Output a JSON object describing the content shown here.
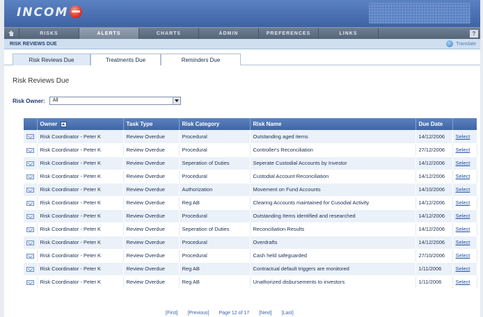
{
  "app": {
    "logo": "INCOM"
  },
  "nav": {
    "items": [
      {
        "label": "RISKS",
        "active": false
      },
      {
        "label": "ALERTS",
        "active": true
      },
      {
        "label": "CHARTS",
        "active": false
      },
      {
        "label": "ADMIN",
        "active": false
      },
      {
        "label": "PREFERENCES",
        "active": false
      },
      {
        "label": "LINKS",
        "active": false
      }
    ],
    "help": "?"
  },
  "section": {
    "title": "RISK REVIEWS DUE",
    "translate": "Translate"
  },
  "tabs": [
    {
      "label": "Risk Reviews Due",
      "active": true
    },
    {
      "label": "Treatments Due",
      "active": false
    },
    {
      "label": "Reminders Due",
      "active": false
    }
  ],
  "page": {
    "heading": "Risk Reviews Due"
  },
  "filter": {
    "label": "Risk Owner:",
    "value": "All"
  },
  "table": {
    "headers": [
      "Owner",
      "Task Type",
      "Risk Category",
      "Risk Name",
      "Due Date"
    ],
    "select_label": "Select",
    "rows": [
      {
        "owner": "Risk Coordinator - Peter K",
        "task": "Review Overdue",
        "category": "Procedural",
        "name": "Outstanding aged items",
        "due": "14/12/2006"
      },
      {
        "owner": "Risk Coordinator - Peter K",
        "task": "Review Overdue",
        "category": "Procedural",
        "name": "Controller's Reconciliation",
        "due": "27/12/2006"
      },
      {
        "owner": "Risk Coordinator - Peter K",
        "task": "Review Overdue",
        "category": "Seperation of Duties",
        "name": "Seperate Custodial Accounts by Investor",
        "due": "14/12/2006"
      },
      {
        "owner": "Risk Coordinator - Peter K",
        "task": "Review Overdue",
        "category": "Procedural",
        "name": "Custodial Account Reconciliation",
        "due": "14/12/2006"
      },
      {
        "owner": "Risk Coordinator - Peter K",
        "task": "Review Overdue",
        "category": "Authorization",
        "name": "Movement on Fund Accounts",
        "due": "14/10/2006"
      },
      {
        "owner": "Risk Coordinator - Peter K",
        "task": "Review Overdue",
        "category": "Reg AB",
        "name": "Clearing Accounts maintained for Cusodial Activity",
        "due": "14/12/2006"
      },
      {
        "owner": "Risk Coordinator - Peter K",
        "task": "Review Overdue",
        "category": "Procedural",
        "name": "Outstanding Items identified and researched",
        "due": "14/12/2006"
      },
      {
        "owner": "Risk Coordinator - Peter K",
        "task": "Review Overdue",
        "category": "Seperation of Duties",
        "name": "Reconciliation Results",
        "due": "14/12/2006"
      },
      {
        "owner": "Risk Coordinator - Peter K",
        "task": "Review Overdue",
        "category": "Procedural",
        "name": "Overdrafts",
        "due": "14/12/2006"
      },
      {
        "owner": "Risk Coordinator - Peter K",
        "task": "Review Overdue",
        "category": "Procedural",
        "name": "Cash held safeguarded",
        "due": "27/10/2006"
      },
      {
        "owner": "Risk Coordinator - Peter K",
        "task": "Review Overdue",
        "category": "Reg AB",
        "name": "Contractual default triggers are monitored",
        "due": "1/11/2006"
      },
      {
        "owner": "Risk Coordinator - Peter K",
        "task": "Review Overdue",
        "category": "Reg AB",
        "name": "Unathorized disbursements to investors",
        "due": "1/11/2006"
      }
    ]
  },
  "pager": {
    "first": "[First]",
    "previous": "[Previous]",
    "page": "Page 12 of 17",
    "next": "[Next]",
    "last": "[Last]"
  }
}
